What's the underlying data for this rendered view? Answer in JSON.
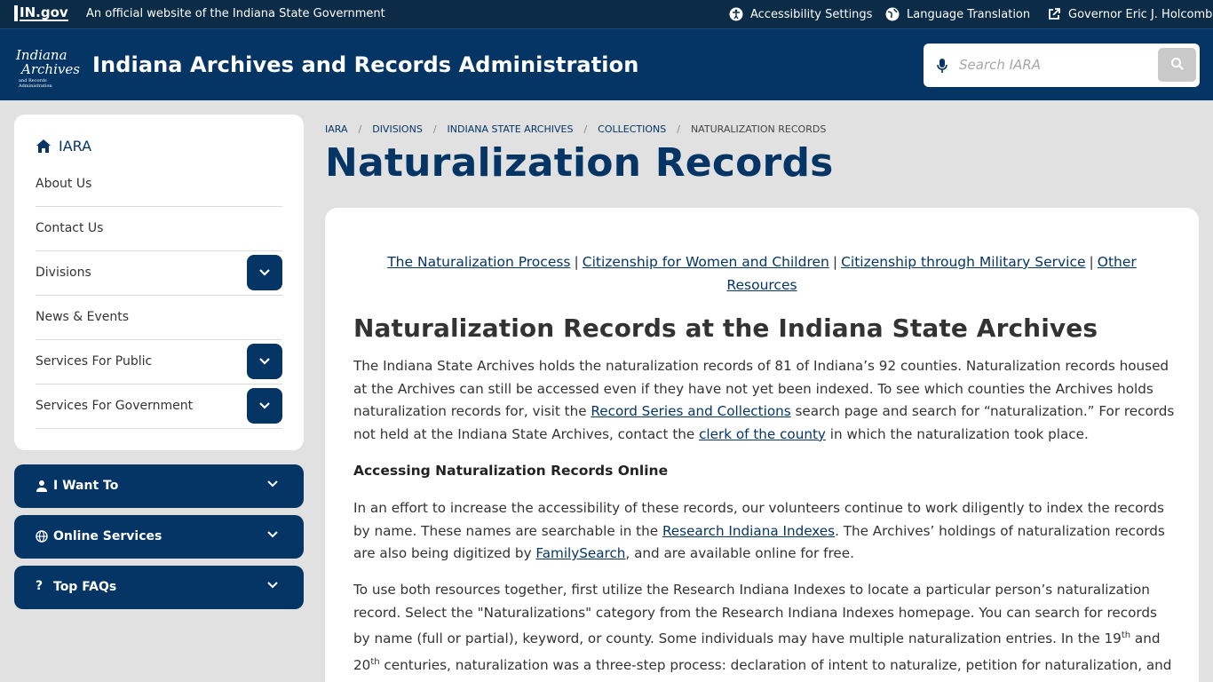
{
  "topbar": {
    "logo_text": "IN.gov",
    "official": "An official website of the Indiana State Government",
    "links": [
      {
        "label": "Accessibility Settings",
        "icon": "accessibility-icon"
      },
      {
        "label": "Language Translation",
        "icon": "globe-icon"
      },
      {
        "label": "Governor Eric J. Holcomb",
        "icon": "external-link-icon"
      }
    ]
  },
  "header": {
    "logo_lines": [
      "Indiana",
      "Archives",
      "and Records Administration"
    ],
    "title": "Indiana Archives and Records Administration",
    "search_placeholder": "Search IARA"
  },
  "sidenav": {
    "home_label": "IARA",
    "items": [
      {
        "label": "About Us",
        "expandable": false
      },
      {
        "label": "Contact Us",
        "expandable": false
      },
      {
        "label": "Divisions",
        "expandable": true
      },
      {
        "label": "News & Events",
        "expandable": false
      },
      {
        "label": "Services For Public",
        "expandable": true
      },
      {
        "label": "Services For Government",
        "expandable": true
      }
    ]
  },
  "accordions": [
    {
      "label": "I Want To",
      "icon": "user-icon"
    },
    {
      "label": "Online Services",
      "icon": "globe-icon"
    },
    {
      "label": "Top FAQs",
      "icon": "question-icon"
    }
  ],
  "breadcrumb": [
    "IARA",
    "DIVISIONS",
    "INDIANA STATE ARCHIVES",
    "COLLECTIONS",
    "NATURALIZATION RECORDS"
  ],
  "page_title": "Naturalization Records",
  "content": {
    "quicklinks": [
      "The Naturalization Process",
      "Citizenship for Women and Children",
      "Citizenship through Military Service",
      "Other Resources "
    ],
    "heading": "Naturalization Records at the Indiana State Archives",
    "p1": {
      "a": "The Indiana State Archives holds the naturalization records of 81 of Indiana’s 92 counties. Naturalization records housed at the Archives can still be accessed even if they have not yet been indexed. To see which counties the Archives holds naturalization records for, visit the ",
      "link1": "Record Series and Collections",
      "b": " search page and search for “naturalization.” For records not held at the Indiana State Archives, contact the ",
      "link2": "clerk of the county",
      "c": " in which the naturalization took place."
    },
    "subheading": "Accessing Naturalization Records Online",
    "p2": {
      "a": "In an effort to increase the accessibility of these records, our volunteers continue to work diligently to index the records by name. These names are searchable in the ",
      "link1": "Research Indiana Indexes",
      "b": ". The Archives’ holdings of naturalization records are also being digitized by ",
      "link2": "FamilySearch",
      "c": ", and are available online for free."
    },
    "p3": {
      "a": "To use both resources together, first utilize the Research Indiana Indexes to locate a particular person’s naturalization record. Select the \"Naturalizations\" category from the Research Indiana Indexes homepage. You can search for records by name (full or partial), keyword, or county. Some individuals may have multiple naturalization entries. In the 19",
      "sup1": "th",
      "b": " and 20",
      "sup2": "th",
      "c": " centuries, naturalization was a three-step process: declaration of intent to naturalize, petition for naturalization, and finally a certificate or court order granting citizenship. Many immigrants never completed the full naturalization process."
    }
  }
}
